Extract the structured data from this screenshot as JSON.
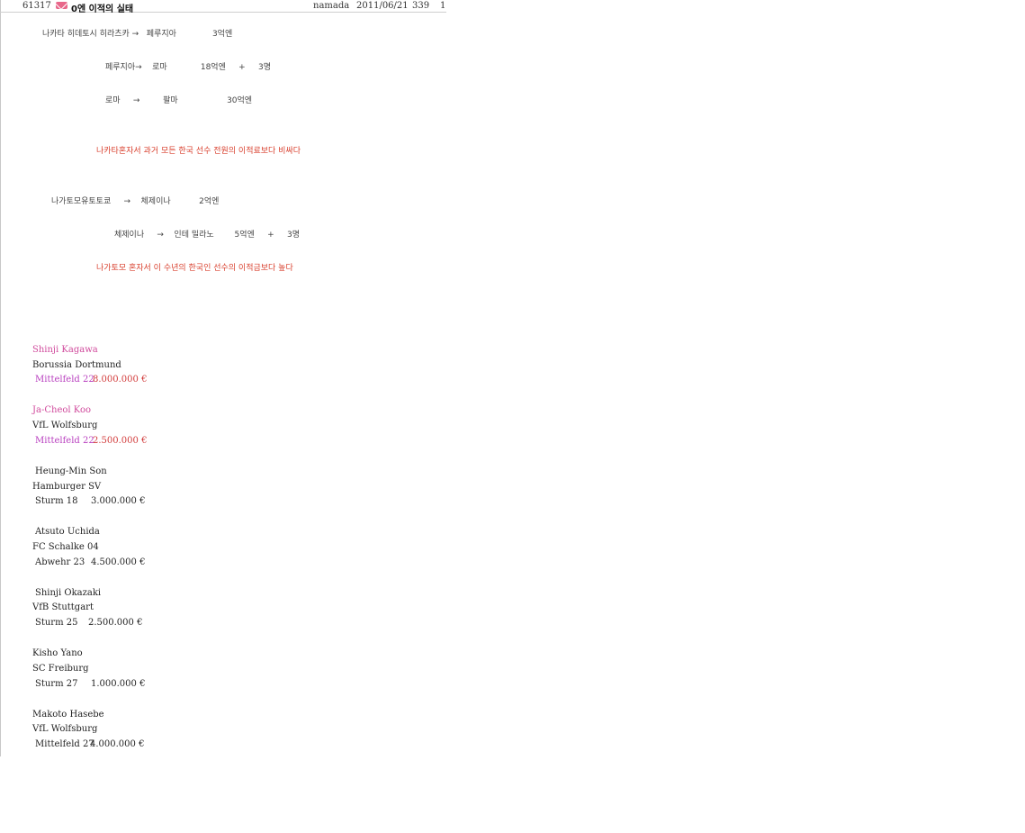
{
  "post": {
    "id": "61317",
    "title": "0엔 이적의 실태",
    "author": "namada",
    "date": "2011/06/21",
    "views": "339",
    "recommends": "1",
    "icon": "mail-icon"
  },
  "content": {
    "lines": [
      "나카타 히데토시 히라츠카 →   페루지아              3억엔",
      "페루지아→    로마             18억엔     +     3명",
      "로마     →         팔마                   30억엔",
      "나카타혼자서 과거 모든 한국 선수 전원의 이적료보다 비싸다",
      "나가토모유토토쿄     →    체제이나           2억엔",
      "체제이나     →    인테 밀라노        5억엔     +     3명",
      "나가토모 혼자서 이 수년의 한국인 선수의 이적금보다 높다"
    ]
  },
  "players": [
    {
      "name": "Shinji Kagawa",
      "club": "Borussia Dortmund",
      "position": "Mittelfeld 22",
      "value": "8.000.000 €"
    },
    {
      "name": "Ja-Cheol Koo",
      "club": "VfL Wolfsburg",
      "position": "Mittelfeld 22",
      "value": "2.500.000 €"
    },
    {
      "name": "Heung-Min Son",
      "club": "Hamburger SV",
      "position": "Sturm 18",
      "value": "3.000.000 €"
    },
    {
      "name": "Atsuto Uchida",
      "club": "FC Schalke 04",
      "position": "Abwehr 23",
      "value": "4.500.000 €"
    },
    {
      "name": "Shinji Okazaki",
      "club": "VfB Stuttgart",
      "position": "Sturm 25",
      "value": "2.500.000 €"
    },
    {
      "name": "Kisho Yano",
      "club": "SC Freiburg",
      "position": "Sturm 27",
      "value": "1.000.000 €"
    },
    {
      "name": "Makoto Hasebe",
      "club": "VfL Wolfsburg",
      "position": "Mittelfeld 27",
      "value": "4.000.000 €"
    }
  ],
  "colors": {
    "accent_red": "#d9412f",
    "name_pink": "#d04a9c",
    "position_pink": "#b83fbf",
    "value_red": "#d23c3c"
  }
}
